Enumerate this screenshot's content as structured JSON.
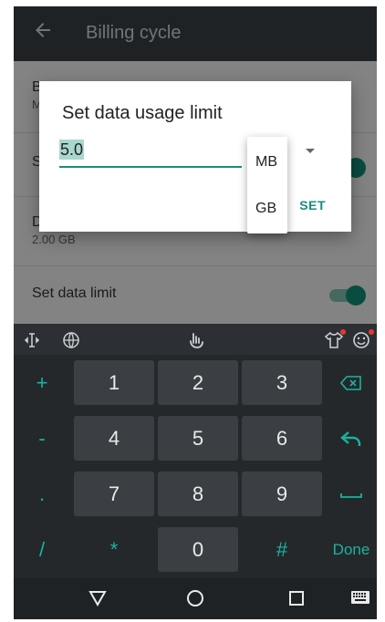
{
  "appbar": {
    "title": "Billing cycle"
  },
  "settings": {
    "item1_label": "B",
    "item1_sub": "M",
    "item2_label": "S",
    "item3_label": "D",
    "item3_sub": "2.00 GB",
    "item4_label": "Set data limit"
  },
  "dialog": {
    "title": "Set data usage limit",
    "value": "5.0",
    "set_label": "SET"
  },
  "unit_menu": {
    "options": [
      "MB",
      "GB"
    ]
  },
  "keyboard": {
    "keys": {
      "r1": [
        "+",
        "1",
        "2",
        "3"
      ],
      "r2": [
        "-",
        "4",
        "5",
        "6"
      ],
      "r3": [
        ".",
        "7",
        "8",
        "9"
      ],
      "r4": [
        "/",
        "*",
        "0",
        "#"
      ],
      "done": "Done"
    }
  },
  "colors": {
    "accent": "#1a8c7c",
    "keyboard_bg": "#25282b",
    "key_bg": "#3b3f43",
    "fn_key": "#19b3a0"
  }
}
